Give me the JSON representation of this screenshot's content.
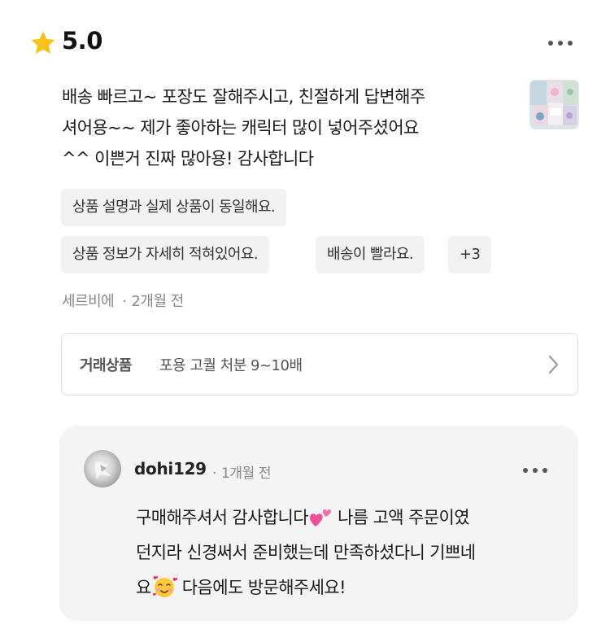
{
  "review": {
    "rating": "5.0",
    "text_lines": [
      "배송 빠르고~ 포장도 잘해주시고, 친절하게 답변해주",
      "셔어용~~ 제가 좋아하는 캐릭터 많이 넣어주셨어요",
      "^^ 이쁜거 진짜 많아용! 감사합니다"
    ],
    "tags": [
      "상품 설명과 실제 상품이 동일해요.",
      "상품 정보가 자세히 적혀있어요.",
      "배송이 빨라요.",
      "+3"
    ],
    "author": "세르비에",
    "time": "2개월 전",
    "separator": "·"
  },
  "product": {
    "label": "거래상품",
    "name": "포용 고퀄 처분 9~10배"
  },
  "reply": {
    "seller": "dohi129",
    "separator": "·",
    "time": "1개월 전",
    "line1": "구매해주셔서 감사합니다",
    "line1_tail": " 나름 고액 주문이였",
    "line2": "던지라 신경써서 준비했는데 만족하셨다니 기쁘네",
    "line3_head": "요",
    "line3_tail": " 다음에도 방문해주세요!"
  },
  "icons": {
    "star": "star-icon",
    "more": "more-dots-icon",
    "chevron": "chevron-right-icon",
    "hearts_emoji": "two-hearts-emoji",
    "smiling_hearts_emoji": "smiling-face-with-hearts-emoji"
  },
  "colors": {
    "star": "#F7C21A",
    "tag_bg": "#F2F2F2",
    "reply_bg": "#F4F4F4",
    "meta_text": "#888888"
  }
}
